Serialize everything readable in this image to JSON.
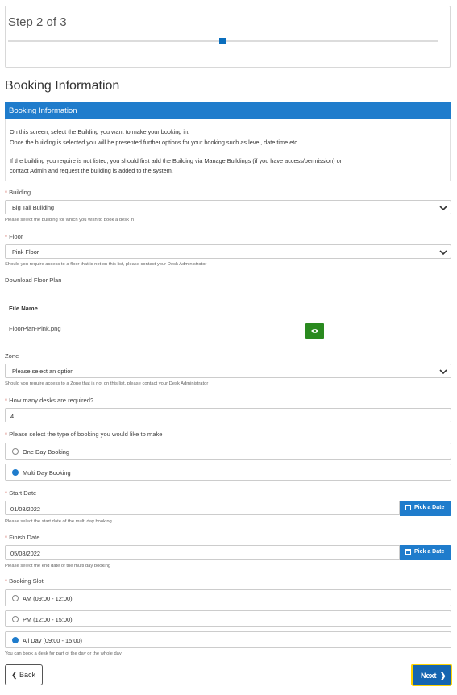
{
  "stepper": {
    "title": "Step 2 of 3",
    "progress": 0.5
  },
  "heading": "Booking Information",
  "info": {
    "bar_title": "Booking Information",
    "line1": "On this screen, select the Building you want to make your booking in.",
    "line2": "Once the building is selected you will be presented further options for your booking such as level, date,time etc.",
    "line3": "If the building you require is not listed, you should first add the Building via Manage Buildings (if you have access/permission) or",
    "line4": "contact Admin and request the building is added to the system."
  },
  "required_mark": "*",
  "building": {
    "label": "Building",
    "value": "Big Tall Building",
    "help": "Please select the building for which you wish to book a desk in"
  },
  "floor": {
    "label": "Floor",
    "value": "Pink Floor",
    "help": "Should you require access to a floor that is not on this list, please contact your Desk Administrator"
  },
  "floor_plan": {
    "link": "Download Floor Plan",
    "column_header": "File Name",
    "file_name": "FloorPlan-Pink.png",
    "view_icon": "eye-icon"
  },
  "zone": {
    "label": "Zone",
    "placeholder": "Please select an option",
    "help": "Should you require access to a Zone that is not on this list, please contact your Desk Administrator"
  },
  "desks": {
    "label": "How many desks are required?",
    "value": "4"
  },
  "booking_type": {
    "label": "Please select the type of booking you would like to make",
    "options": [
      "One Day Booking",
      "Multi Day Booking"
    ],
    "selected": "Multi Day Booking"
  },
  "start_date": {
    "label": "Start Date",
    "value": "01/08/2022",
    "button": "Pick a Date",
    "help": "Please select the start date of the multi day booking"
  },
  "finish_date": {
    "label": "Finish Date",
    "value": "05/08/2022",
    "button": "Pick a Date",
    "help": "Please select the end date of the multi day booking"
  },
  "booking_slot": {
    "label": "Booking Slot",
    "options": [
      "AM (09:00 - 12:00)",
      "PM (12:00 - 15:00)",
      "All Day (09:00 - 15:00)"
    ],
    "selected": "All Day (09:00 - 15:00)",
    "help": "You can book a desk for part of the day or the whole day"
  },
  "nav": {
    "back": "Back",
    "next": "Next"
  },
  "colors": {
    "primary": "#1f7ccc",
    "success": "#2a8a1f",
    "focus": "#ffd200",
    "required": "#c0392b"
  }
}
